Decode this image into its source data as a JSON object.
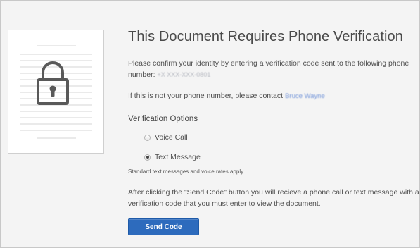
{
  "header": {
    "title": "This Document Requires Phone Verification"
  },
  "body": {
    "confirm_text": "Please confirm your identity by entering a verification code sent to the following phone number:",
    "phone_number": "+X XXX-XXX-0801",
    "not_your_number_text": "If this is not your phone number, please contact",
    "contact_name": "Bruce Wayne"
  },
  "verification": {
    "title": "Verification Options",
    "options": [
      {
        "label": "Voice Call",
        "selected": false
      },
      {
        "label": "Text Message",
        "selected": true
      }
    ],
    "rates_note": "Standard text messages and voice rates apply"
  },
  "instructions": "After clicking the \"Send Code\" button you will recieve a phone call or text message with a verification code that you must enter to view the document.",
  "send_button_label": "Send Code",
  "icons": {
    "document": "document-icon",
    "lock": "lock-icon",
    "radio_unchecked": "radio-unchecked-icon",
    "radio_checked": "radio-checked-icon"
  },
  "colors": {
    "accent": "#2d6bbd",
    "link": "#6f92d8",
    "background": "#f4f4f4"
  }
}
